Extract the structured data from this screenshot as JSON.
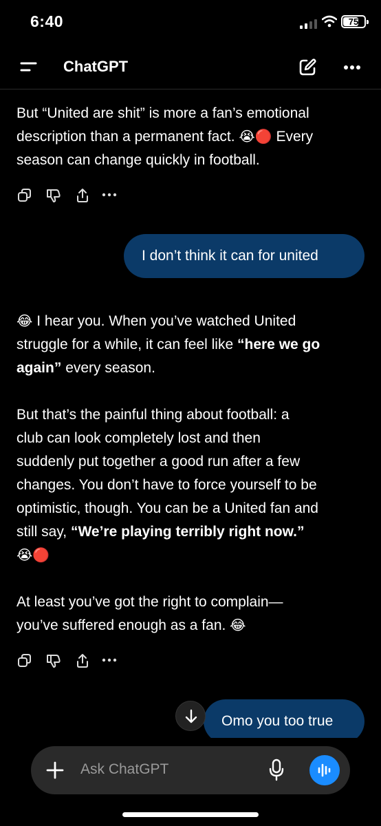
{
  "status": {
    "time": "6:40",
    "battery": "75",
    "battery_level": 0.75
  },
  "nav": {
    "title": "ChatGPT"
  },
  "messages": {
    "a1": {
      "p1": "But “United are shit” is more a fan’s emotional",
      "p2": "description than a permanent fact. ",
      "p2_emoji": "😭🔴",
      "p2_tail": " Every",
      "p3": "season can change quickly in football."
    },
    "u1": "I don’t think it can for united",
    "a2": {
      "l1_emoji": "😂",
      "l1": " I hear you. When you’ve watched United",
      "l2a": "struggle for a while, it can feel like ",
      "l2b": "“here we go",
      "l3a": "again”",
      "l3b": " every season.",
      "p2_1": "But that’s the painful thing about football: a",
      "p2_2": "club can look completely lost and then",
      "p2_3": "suddenly put together a good run after a few",
      "p2_4": "changes. You don’t have to force yourself to be",
      "p2_5": "optimistic, though. You can be a United fan and",
      "p2_6a": "still say, ",
      "p2_6b": "“We’re playing terribly right now.”",
      "p2_7_emoji": "😭🔴",
      "p3_1": "At least you’ve got the right to complain—",
      "p3_2": "you’ve suffered enough as a fan. ",
      "p3_2_emoji": "😂"
    },
    "u2": "Omo you too true"
  },
  "input": {
    "placeholder": "Ask ChatGPT"
  },
  "icons": {
    "menu": "menu-icon",
    "edit": "new-chat-icon",
    "more": "more-icon",
    "copy": "copy-icon",
    "dislike": "thumbs-down-icon",
    "share": "share-icon",
    "scroll": "arrow-down-icon",
    "plus": "plus-icon",
    "mic": "mic-icon",
    "voice": "voice-waveform-icon"
  },
  "colors": {
    "background": "#000000",
    "user_bubble": "#0b3a68",
    "input_bg": "#2a2a2a",
    "voice_button": "#1a8cff"
  }
}
